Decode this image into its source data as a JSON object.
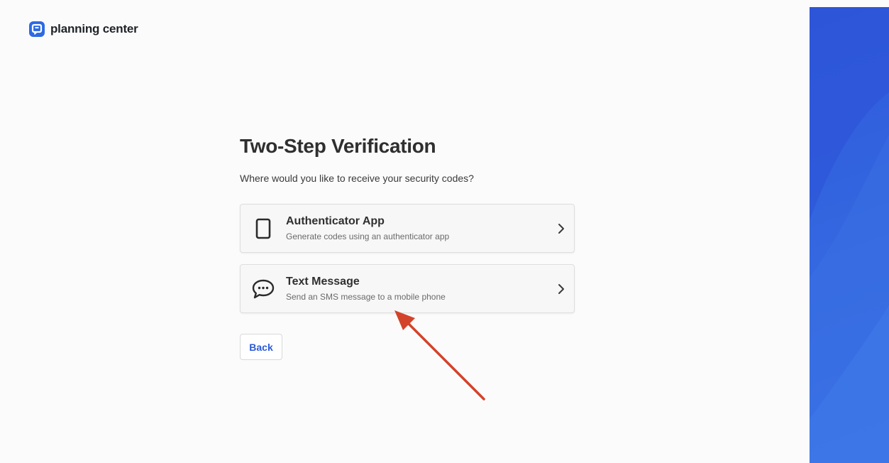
{
  "brand": {
    "name": "planning center",
    "logo_icon": "planning-center-logo"
  },
  "page": {
    "title": "Two-Step Verification",
    "subtitle": "Where would you like to receive your security codes?"
  },
  "options": [
    {
      "title": "Authenticator App",
      "description": "Generate codes using an authenticator app",
      "icon": "mobile-phone-icon"
    },
    {
      "title": "Text Message",
      "description": "Send an SMS message to a mobile phone",
      "icon": "chat-bubble-icon"
    }
  ],
  "back_button": {
    "label": "Back"
  },
  "colors": {
    "accent": "#2d5bd6",
    "annotation_arrow": "#d2432a",
    "side_panel": "#3466e0",
    "background": "#fbfbfb"
  }
}
